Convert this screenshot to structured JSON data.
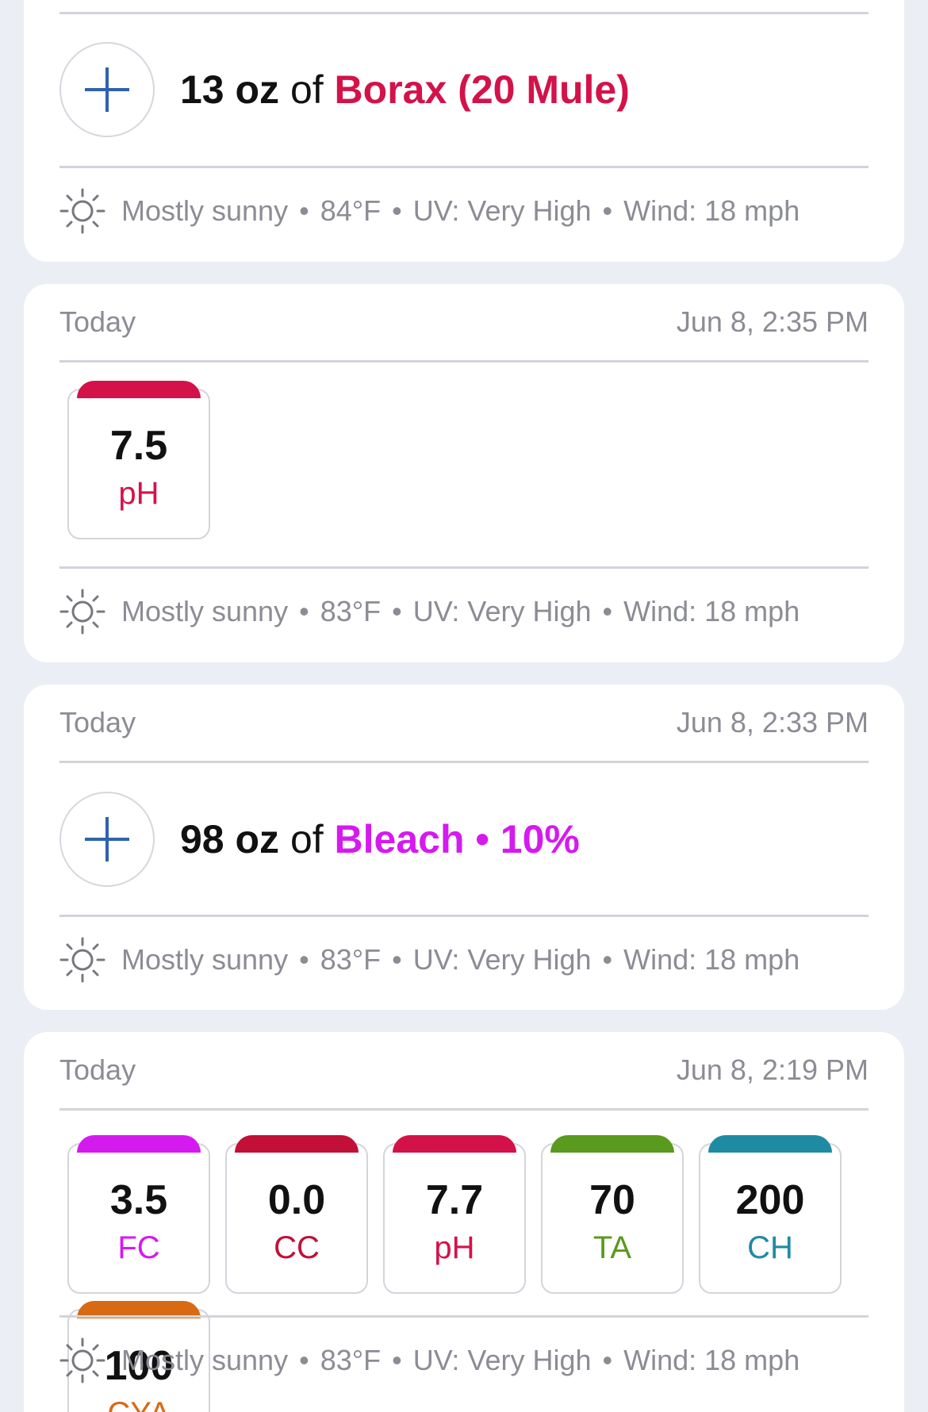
{
  "colors": {
    "ph": "#d4124a",
    "borax": "#d4124a",
    "fc": "#d51aef",
    "bleach": "#d51aef",
    "cc": "#c21038",
    "ta": "#5a9a1e",
    "ch": "#1f8ba3",
    "cya": "#d86a14",
    "plus": "#2f62b0"
  },
  "card1": {
    "amount": "13 oz",
    "of_word": " of ",
    "chemical": "Borax (20 Mule)",
    "weather": {
      "condition": "Mostly sunny",
      "temp": "84°F",
      "uv": "UV: Very High",
      "wind": "Wind: 18 mph"
    }
  },
  "card2": {
    "day": "Today",
    "time": "Jun 8, 2:35 PM",
    "readings": [
      {
        "value": "7.5",
        "label": "pH"
      }
    ],
    "weather": {
      "condition": "Mostly sunny",
      "temp": "83°F",
      "uv": "UV: Very High",
      "wind": "Wind: 18 mph"
    }
  },
  "card3": {
    "day": "Today",
    "time": "Jun 8, 2:33 PM",
    "amount": "98 oz",
    "of_word": " of ",
    "chemical": "Bleach • 10%",
    "weather": {
      "condition": "Mostly sunny",
      "temp": "83°F",
      "uv": "UV: Very High",
      "wind": "Wind: 18 mph"
    }
  },
  "card4": {
    "day": "Today",
    "time": "Jun 8, 2:19 PM",
    "readings": [
      {
        "value": "3.5",
        "label": "FC"
      },
      {
        "value": "0.0",
        "label": "CC"
      },
      {
        "value": "7.7",
        "label": "pH"
      },
      {
        "value": "70",
        "label": "TA"
      },
      {
        "value": "200",
        "label": "CH"
      },
      {
        "value": "100",
        "label": "CYA"
      }
    ],
    "weather": {
      "condition": "Mostly sunny",
      "temp": "83°F",
      "uv": "UV: Very High",
      "wind": "Wind: 18 mph"
    }
  },
  "separator": "•"
}
